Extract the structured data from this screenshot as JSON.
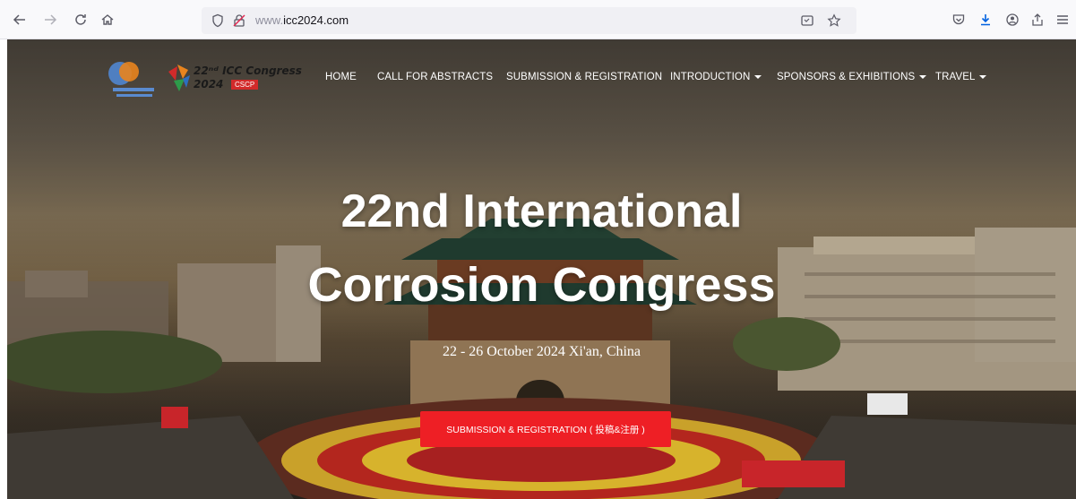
{
  "browser": {
    "url_host": "www.",
    "url_domain": "icc2024.com"
  },
  "logos": {
    "congress_line1": "22ⁿᵈ ICC Congress",
    "congress_year": "2024",
    "congress_badge": "CSCP"
  },
  "nav": {
    "home": "HOME",
    "abstracts": "CALL FOR ABSTRACTS",
    "submission": "SUBMISSION & REGISTRATION",
    "introduction": "INTRODUCTION",
    "sponsors": "SPONSORS & EXHIBITIONS",
    "travel": "TRAVEL"
  },
  "hero": {
    "title_line1": "22nd International",
    "title_line2": "Corrosion Congress",
    "subtitle": "22 - 26 October 2024 Xi'an, China",
    "cta_label": "SUBMISSION & REGISTRATION ( 投稿&注册 )"
  }
}
